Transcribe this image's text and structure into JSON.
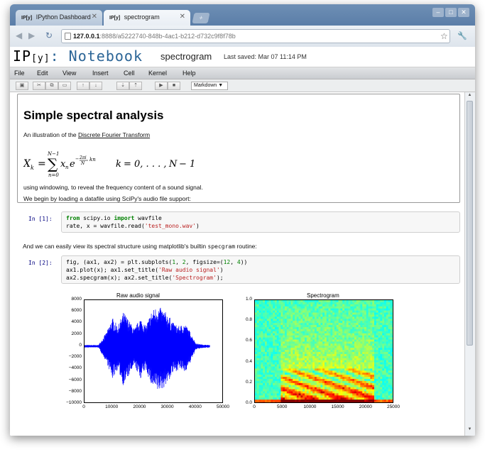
{
  "browser": {
    "tabs": [
      {
        "favicon": "IP[y]",
        "label": "IPython Dashboard"
      },
      {
        "favicon": "IP[y]",
        "label": "spectrogram"
      }
    ],
    "url_host": "127.0.0.1",
    "url_path": ":8888/a5222740-848b-4ac1-b212-d732c9f8f78b"
  },
  "notebook": {
    "logo_ip": "IP",
    "logo_y": "[y]",
    "logo_colon": ":",
    "logo_notebook": "Notebook",
    "name": "spectrogram",
    "last_saved": "Last saved: Mar 07 11:14 PM",
    "menu": [
      "File",
      "Edit",
      "View",
      "Insert",
      "Cell",
      "Kernel",
      "Help"
    ],
    "cell_type": "Markdown ▼"
  },
  "markdown_cell": {
    "heading": "Simple spectral analysis",
    "intro_prefix": "An illustration of the ",
    "intro_link": "Discrete Fourier Transform",
    "windowing_text": "using windowing, to reveal the frequency content of a sound signal.",
    "loading_text": "We begin by loading a datafile using SciPy's audio file support:"
  },
  "cell1": {
    "prompt": "In [1]:",
    "line1_kw1": "from",
    "line1_mod": " scipy.io ",
    "line1_kw2": "import",
    "line1_rest": " wavfile",
    "line2_pre": "rate, x = wavfile.read(",
    "line2_str": "'test_mono.wav'",
    "line2_post": ")"
  },
  "between_text_pre": "And we can easily view its spectral structure using matplotlib's builtin ",
  "between_text_code": "specgram",
  "between_text_post": " routine:",
  "cell2": {
    "prompt": "In [2]:",
    "line1_a": "fig, (ax1, ax2) = plt.subplots(",
    "line1_n1": "1",
    "line1_b": ", ",
    "line1_n2": "2",
    "line1_c": ", figsize=(",
    "line1_n3": "12",
    "line1_d": ", ",
    "line1_n4": "4",
    "line1_e": "))",
    "line2_pre": "ax1.plot(x); ax1.set_title(",
    "line2_str": "'Raw audio signal'",
    "line2_post": ")",
    "line3_pre": "ax2.specgram(x); ax2.set_title(",
    "line3_str": "'Spectrogram'",
    "line3_post": ");"
  },
  "chart_data": [
    {
      "type": "line",
      "title": "Raw audio signal",
      "xlabel": "",
      "ylabel": "",
      "xlim": [
        0,
        50000
      ],
      "ylim": [
        -10000,
        8000
      ],
      "xticks": [
        "0",
        "10000",
        "20000",
        "30000",
        "40000",
        "50000"
      ],
      "yticks": [
        "8000",
        "6000",
        "4000",
        "2000",
        "0",
        "−2000",
        "−4000",
        "−6000",
        "−8000",
        "−10000"
      ],
      "series_color": "#0000ff",
      "x": [
        0,
        5000,
        8000,
        10000,
        12000,
        14000,
        16000,
        18000,
        20000,
        22000,
        24000,
        26000,
        28000,
        30000,
        32000,
        34000,
        36000,
        38000,
        40000,
        42000,
        45000,
        50000
      ],
      "envelope": [
        200,
        200,
        2500,
        5000,
        3500,
        6000,
        4500,
        3000,
        5000,
        3500,
        6000,
        7000,
        6500,
        5500,
        4000,
        3500,
        4000,
        2500,
        500,
        300,
        200,
        200
      ]
    },
    {
      "type": "heatmap",
      "title": "Spectrogram",
      "xlabel": "",
      "ylabel": "",
      "xlim": [
        0,
        25000
      ],
      "ylim": [
        0,
        1.0
      ],
      "xticks": [
        "0",
        "5000",
        "10000",
        "15000",
        "20000",
        "25000"
      ],
      "yticks": [
        "1.0",
        "0.8",
        "0.6",
        "0.4",
        "0.2",
        "0.0"
      ],
      "colormap": "jet"
    }
  ]
}
